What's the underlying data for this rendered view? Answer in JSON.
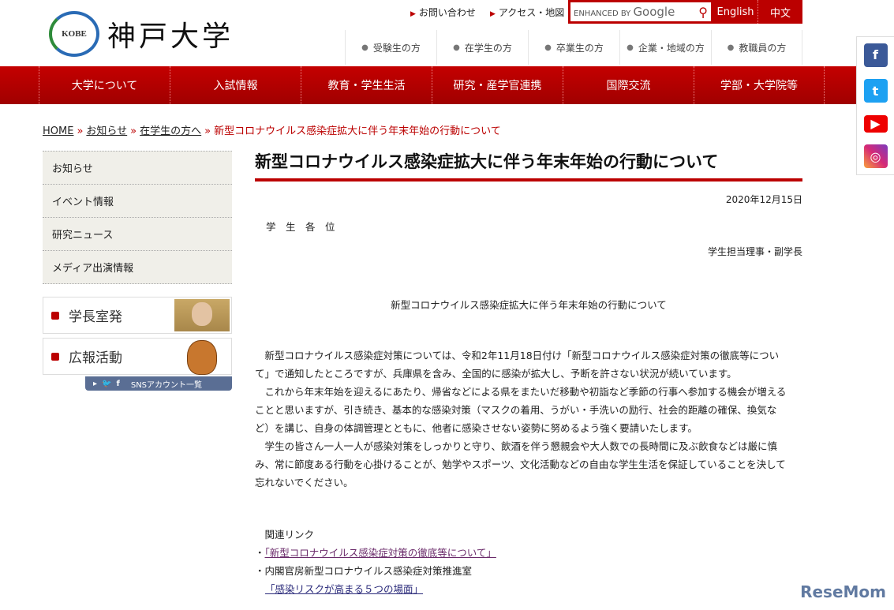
{
  "header": {
    "logo_text": "神戸大学",
    "emblem_text": "KOBE",
    "top_links": [
      "お問い合わせ",
      "アクセス・地図"
    ],
    "search_label": "ENHANCED BY",
    "search_brand": "Google",
    "lang": [
      "English",
      "中文"
    ],
    "audience": [
      "受験生の方",
      "在学生の方",
      "卒業生の方",
      "企業・地域の方",
      "教職員の方"
    ]
  },
  "nav": [
    "大学について",
    "入試情報",
    "教育・学生生活",
    "研究・産学官連携",
    "国際交流",
    "学部・大学院等"
  ],
  "breadcrumb": {
    "items": [
      "HOME",
      "お知らせ",
      "在学生の方へ"
    ],
    "current": "新型コロナウイルス感染症拡大に伴う年末年始の行動について"
  },
  "sidebar": {
    "items": [
      "お知らせ",
      "イベント情報",
      "研究ニュース",
      "メディア出演情報"
    ],
    "banners": [
      "学長室発",
      "広報活動"
    ],
    "sns_label": "SNSアカウント一覧"
  },
  "article": {
    "title": "新型コロナウイルス感染症拡大に伴う年末年始の行動について",
    "date": "2020年12月15日",
    "addressee": "学　生　各　位",
    "sender": "学生担当理事・副学長",
    "subtitle": "新型コロナウイルス感染症拡大に伴う年末年始の行動について",
    "lines": [
      "　新型コロナウイルス感染症対策については、令和2年11月18日付け「新型コロナウイルス感染症対策の徹底等につい",
      "て」で通知したところですが、兵庫県を含み、全国的に感染が拡大し、予断を許さない状況が続いています。",
      "　これから年末年始を迎えるにあたり、帰省などによる県をまたいだ移動や初詣など季節の行事へ参加する機会が増える",
      "ことと思いますが、引き続き、基本的な感染対策（マスクの着用、うがい・手洗いの励行、社会的距離の確保、換気な",
      "ど）を講じ、自身の体調管理とともに、他者に感染させない姿勢に努めるよう強く要請いたします。",
      "　学生の皆さん一人一人が感染対策をしっかりと守り、飲酒を伴う懇親会や大人数での長時間に及ぶ飲食などは厳に慎",
      "み、常に節度ある行動を心掛けることが、勉学やスポーツ、文化活動などの自由な学生生活を保証していることを決して",
      "忘れないでください。"
    ],
    "related_heading": "　関連リンク",
    "bullet": "・",
    "link1": "「新型コロナウイルス感染症対策の徹底等について」",
    "org": "内閣官房新型コロナウイルス感染症対策推進室",
    "link2": "「感染リスクが高まる５つの場面」"
  },
  "watermark": "ReseMom",
  "colors": {
    "brand": "#b00000"
  }
}
